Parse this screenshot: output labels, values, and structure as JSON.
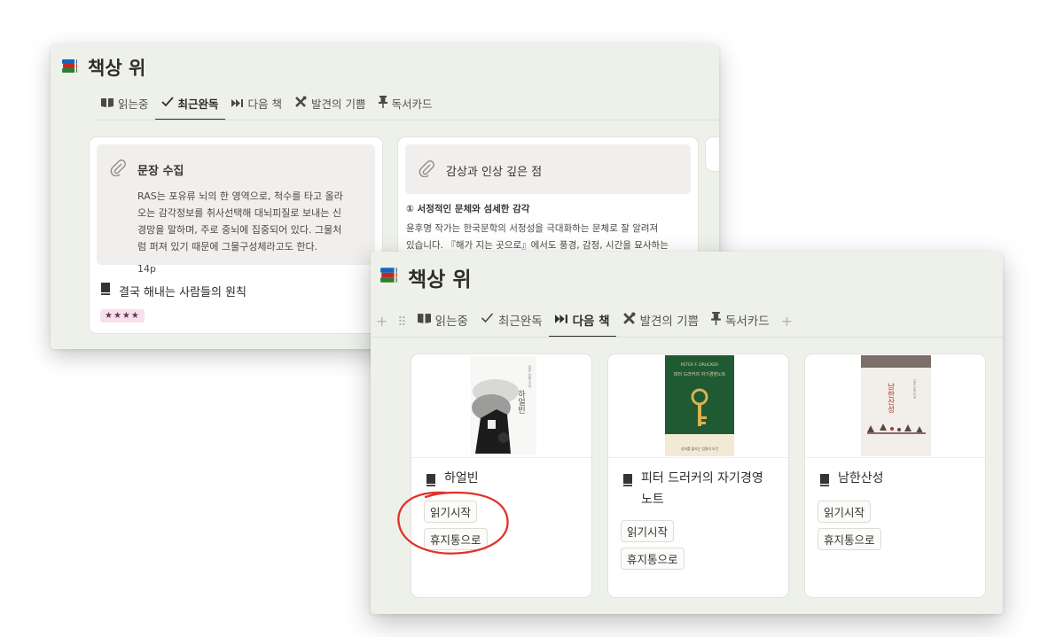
{
  "back": {
    "title": "책상 위",
    "tabs": [
      {
        "label": "읽는중",
        "icon": "open-book-icon"
      },
      {
        "label": "최근완독",
        "icon": "checkmark-icon",
        "active": true
      },
      {
        "label": "다음 책",
        "icon": "fast-forward-icon"
      },
      {
        "label": "발견의 기쁨",
        "icon": "tools-icon"
      },
      {
        "label": "독서카드",
        "icon": "pushpin-icon"
      }
    ],
    "card1": {
      "note_title": "문장 수집",
      "note_lines": [
        "RAS는 포유류 뇌의 한 영역으로, 척수를 타고 올라",
        "오는 감각정보를 취사선택해 대뇌피질로 보내는 신",
        "경망을 말하며, 주로 중뇌에 집중되어 있다. 그물처",
        "럼 퍼져 있기 때문에 그물구성체라고도 한다."
      ],
      "page": "14p",
      "book_title": "결국 해내는 사람들의 원칙",
      "rating": "★★★★"
    },
    "card2": {
      "note_title": "감상과 인상 깊은 점",
      "subheading": "① 서정적인 문체와 섬세한 감각",
      "lines": [
        "윤후명 작가는 한국문학의 서정성을 극대화하는 문체로 잘 알려져",
        "있습니다. 『해가 지는 곳으로』에서도 풍경, 감정, 시간을 묘사하는"
      ]
    }
  },
  "front": {
    "title": "책상 위",
    "tabs": [
      {
        "label": "읽는중",
        "icon": "open-book-icon"
      },
      {
        "label": "최근완독",
        "icon": "checkmark-icon"
      },
      {
        "label": "다음 책",
        "icon": "fast-forward-icon",
        "active": true
      },
      {
        "label": "발견의 기쁨",
        "icon": "tools-icon"
      },
      {
        "label": "독서카드",
        "icon": "pushpin-icon"
      }
    ],
    "books": [
      {
        "title": "하얼빈",
        "cover_text": "하얼빈",
        "cover_author": "김훈 장편소설",
        "actions": [
          "읽기시작",
          "휴지통으로"
        ]
      },
      {
        "title": "피터 드러커의 자기경영",
        "title_line2": "노트",
        "cover_text_top": "PETER F. DRUCKER",
        "cover_text": "피터 드러커의 자기경영노트",
        "cover_blurb": "성과를 올리는 임원의 조건",
        "actions": [
          "읽기시작",
          "휴지통으로"
        ]
      },
      {
        "title": "남한산성",
        "cover_text": "남한산성",
        "cover_author": "김훈 장편소설",
        "actions": [
          "읽기시작",
          "휴지통으로"
        ]
      }
    ]
  },
  "colors": {
    "window_bg": "#eef1ea",
    "note_bg": "#f1efed",
    "rating_bg": "#f6e1eb",
    "drucker_green": "#1f5a33",
    "annotation_red": "#e1322a"
  }
}
